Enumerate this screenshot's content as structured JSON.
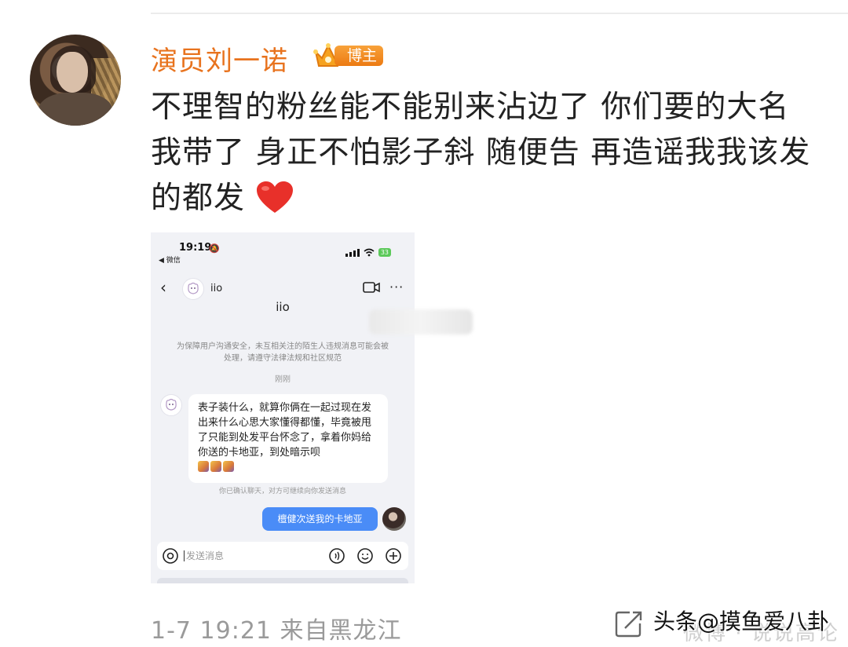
{
  "post": {
    "username": "演员刘一诺",
    "badge": "博主",
    "text": "不理智的粉丝能不能别来沾边了 你们要的大名我带了 身正不怕影子斜 随便告 再造谣我我该发的都发",
    "emoji_icon": "red-heart-icon",
    "time": "1-7 19:21",
    "source": "来自黑龙江"
  },
  "screenshot": {
    "status_time": "19:19",
    "back_app": "◀ 微信",
    "battery": "33",
    "contact_name": "iio",
    "notice": "为保障用户沟通安全，未互相关注的陌生人违规消息可能会被处理，请遵守法律法规和社区规范",
    "timestamp_label": "刚刚",
    "incoming_message": "表子装什么，就算你俩在一起过现在发出来什么心思大家懂得都懂，毕竟被甩了只能到处发平台怀念了，拿着你妈给你送的卡地亚，到处暗示呗",
    "confirm_text": "你已确认聊天，对方可继续向你发送消息",
    "outgoing_message": "檀健次送我的卡地亚",
    "input_placeholder": "发送消息"
  },
  "watermark": {
    "text": "头条@摸鱼爱八卦",
    "background_text": "微博 · 说说高论"
  },
  "colors": {
    "username": "#e8731e",
    "badge": "#ec7a12",
    "outgoing_bubble": "#4a8cf7",
    "meta": "#9a9a9a"
  }
}
